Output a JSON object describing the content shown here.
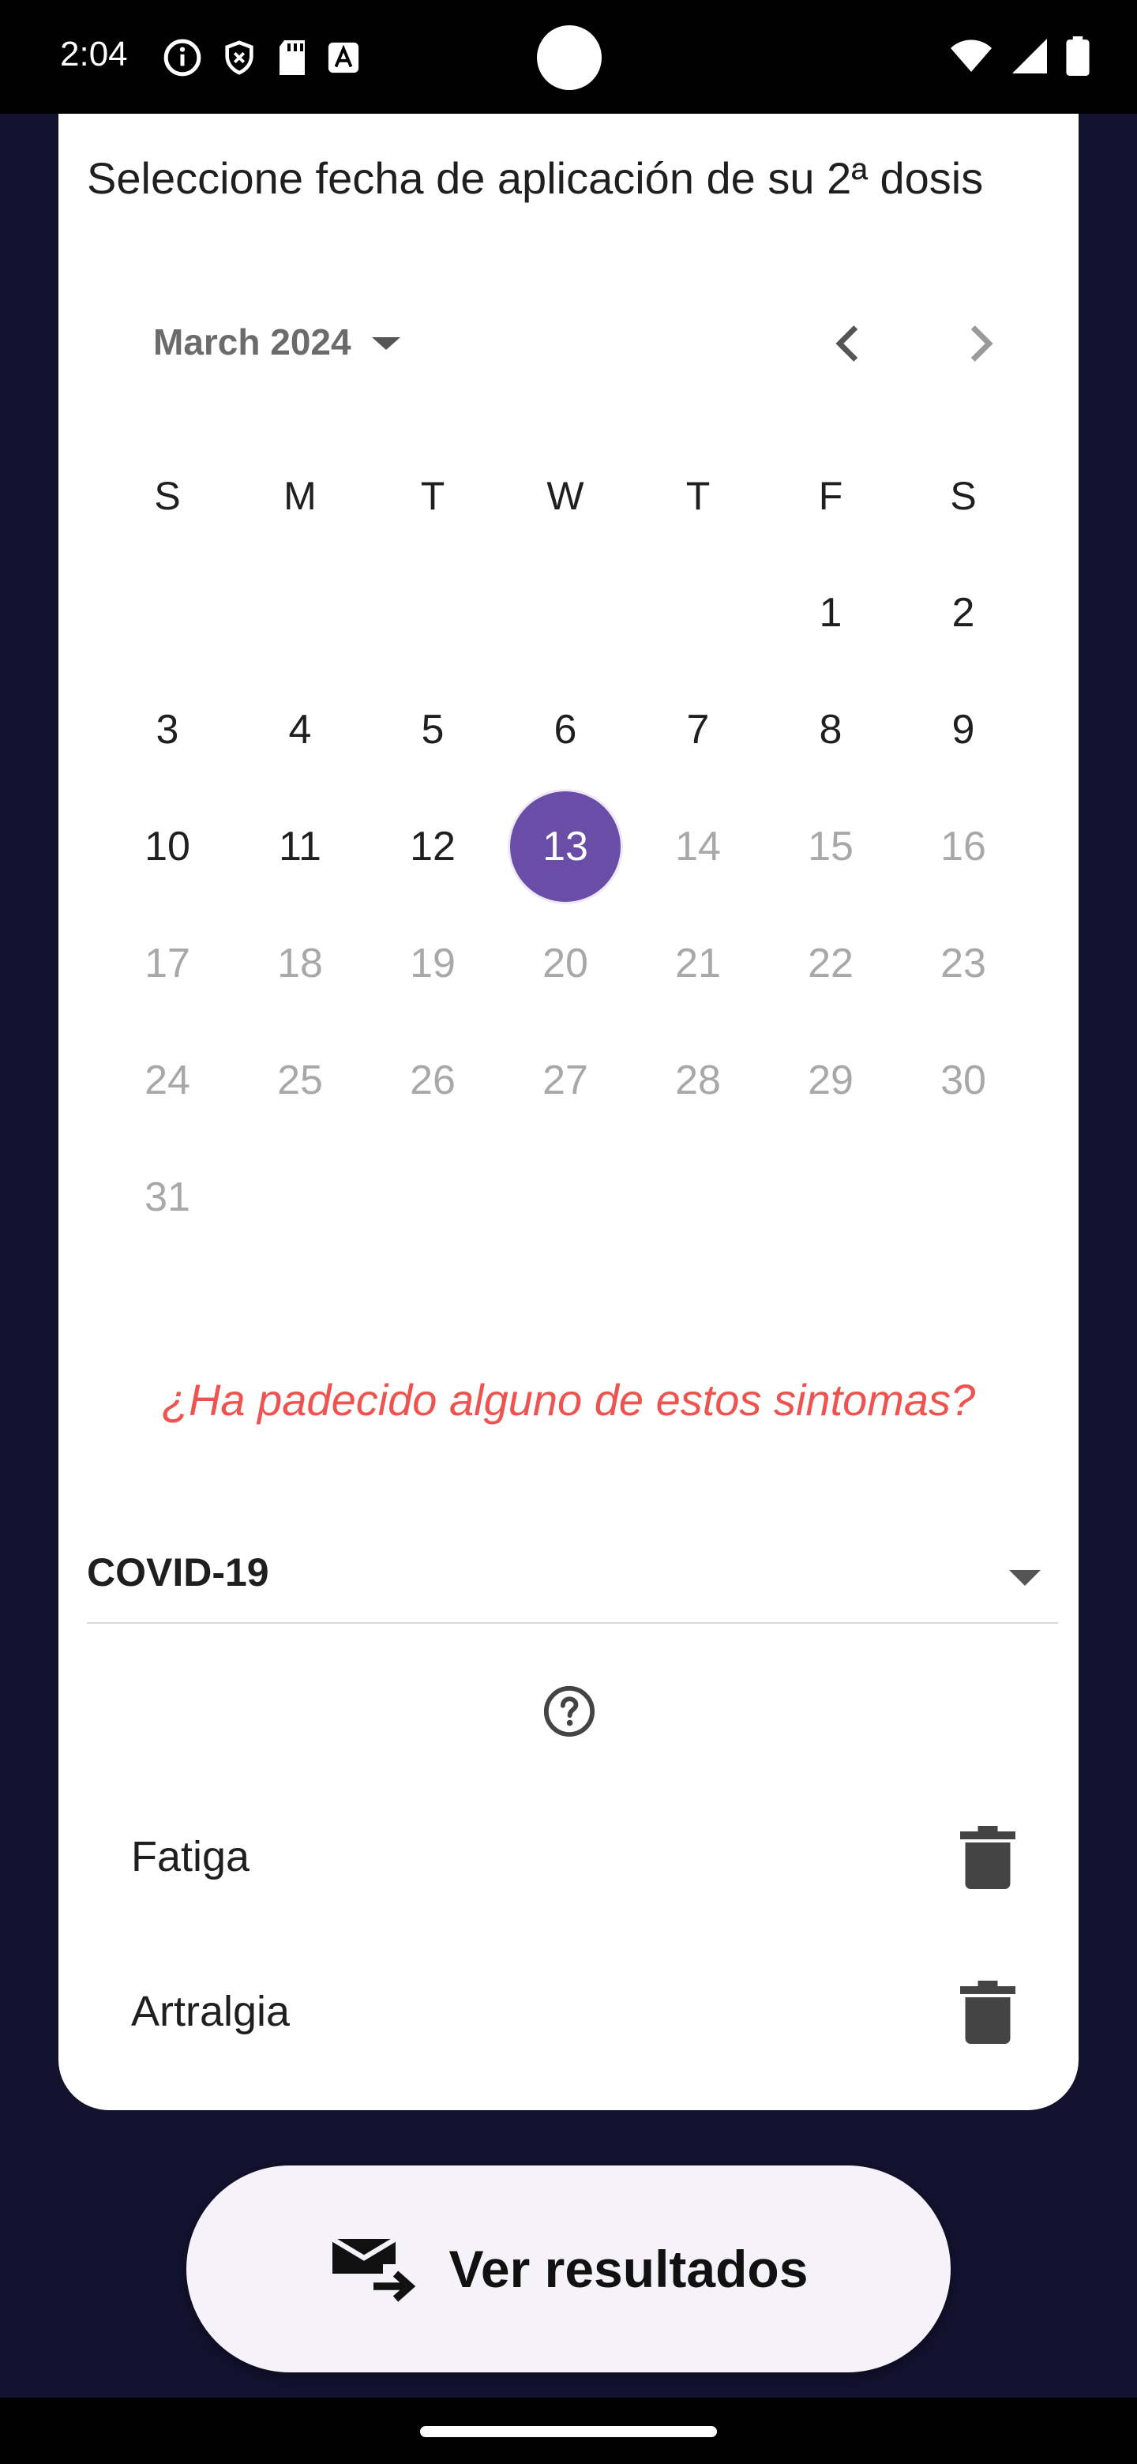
{
  "status_bar": {
    "time": "2:04",
    "left_icons": [
      "info-icon",
      "shield-icon",
      "sd-card-icon",
      "text-icon"
    ],
    "right_icons": [
      "wifi-icon",
      "signal-icon",
      "battery-icon"
    ]
  },
  "screen": {
    "title": "Seleccione fecha de aplicación de su 2ª dosis",
    "calendar": {
      "month_label": "March 2024",
      "weekdays": [
        "S",
        "M",
        "T",
        "W",
        "T",
        "F",
        "S"
      ],
      "weeks": [
        [
          "",
          "",
          "",
          "",
          "",
          "1",
          "2"
        ],
        [
          "3",
          "4",
          "5",
          "6",
          "7",
          "8",
          "9"
        ],
        [
          "10",
          "11",
          "12",
          "13",
          "14",
          "15",
          "16"
        ],
        [
          "17",
          "18",
          "19",
          "20",
          "21",
          "22",
          "23"
        ],
        [
          "24",
          "25",
          "26",
          "27",
          "28",
          "29",
          "30"
        ],
        [
          "31",
          "",
          "",
          "",
          "",
          "",
          ""
        ]
      ],
      "selected_day": "13",
      "selected_color": "#6a4da6"
    },
    "question": "¿Ha padecido alguno de estos sintomas?",
    "question_color": "#ef5350",
    "dropdown": {
      "value": "COVID-19"
    },
    "symptoms": [
      {
        "label": "Fatiga"
      },
      {
        "label": "Artralgia"
      }
    ]
  },
  "action_button": {
    "label": "Ver resultados",
    "icon": "mail-forward-icon"
  }
}
